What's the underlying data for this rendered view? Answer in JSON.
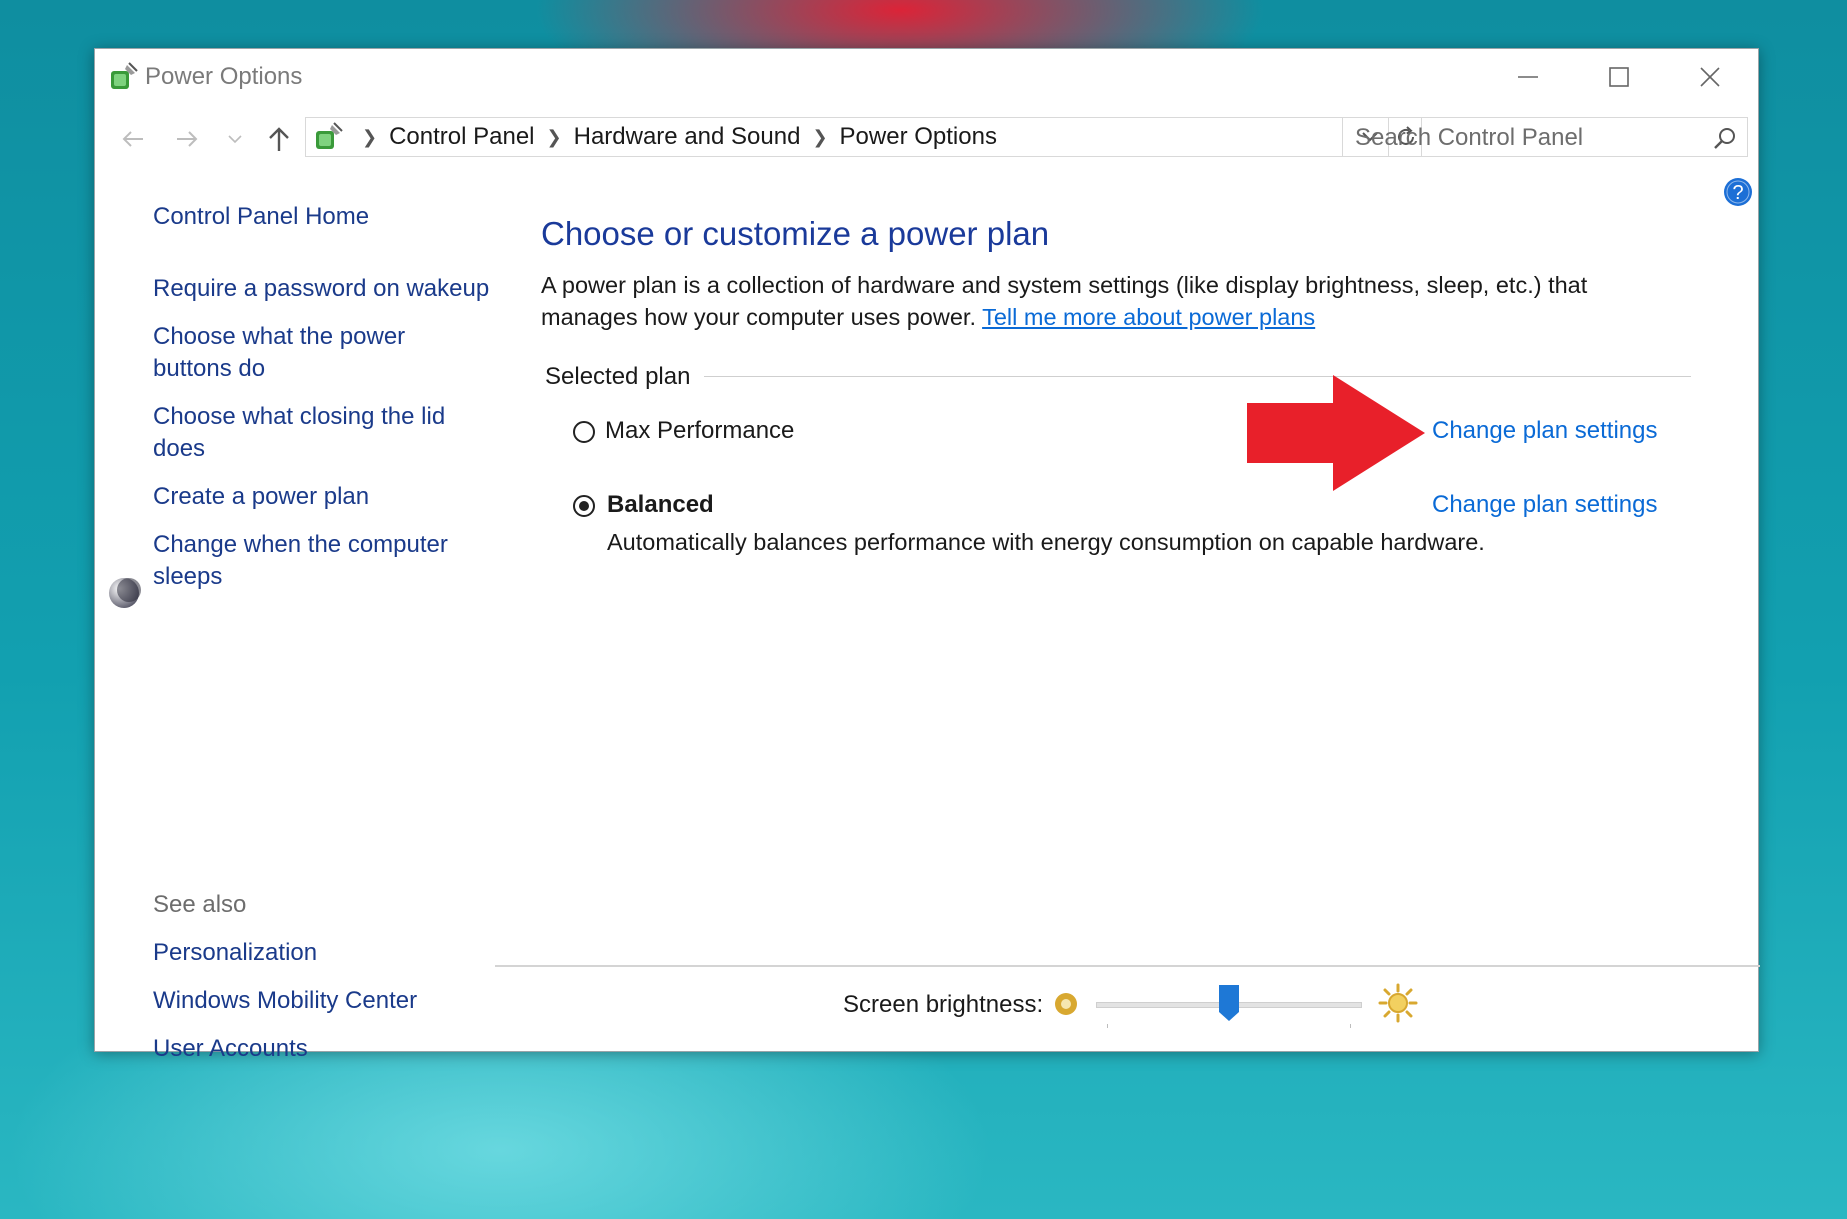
{
  "window": {
    "title": "Power Options"
  },
  "address_bar": {
    "breadcrumbs": [
      "Control Panel",
      "Hardware and Sound",
      "Power Options"
    ]
  },
  "search": {
    "placeholder": "Search Control Panel"
  },
  "left_nav": {
    "home": "Control Panel Home",
    "items": [
      "Require a password on wakeup",
      "Choose what the power buttons do",
      "Choose what closing the lid does",
      "Create a power plan",
      "Change when the computer sleeps"
    ],
    "see_also_label": "See also",
    "see_also": [
      "Personalization",
      "Windows Mobility Center",
      "User Accounts"
    ]
  },
  "main": {
    "title": "Choose or customize a power plan",
    "description": "A power plan is a collection of hardware and system settings (like display brightness, sleep, etc.) that manages how your computer uses power.",
    "more_link": "Tell me more about power plans",
    "group_label": "Selected plan",
    "plans": [
      {
        "name": "Max Performance",
        "selected": false,
        "link": "Change plan settings",
        "description": ""
      },
      {
        "name": "Balanced",
        "selected": true,
        "link": "Change plan settings",
        "description": "Automatically balances performance with energy consumption on capable hardware."
      }
    ]
  },
  "brightness": {
    "label": "Screen brightness:",
    "value_fraction": 0.5
  },
  "colors": {
    "link": "#0a6ad6",
    "nav_link": "#1a3a8a",
    "title": "#1a3a9a",
    "annotation_arrow": "#e8202a",
    "slider_thumb": "#1e78d6"
  }
}
